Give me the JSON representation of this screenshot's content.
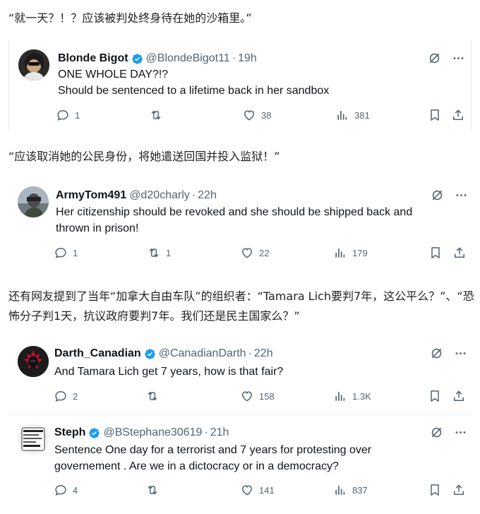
{
  "captions": [
    "“就一天？！？应该被判处终身待在她的沙箱里。”",
    "“应该取消她的公民身份，将她遣送回国并投入监狱！”",
    "还有网友提到了当年“加拿大自由车队”的组织者：“Tamara Lich要判7年，这公平么？”、“恐怖分子判1天，抗议政府要判7年。我们还是民主国家么？”"
  ],
  "tweets": [
    {
      "name": "Blonde Bigot",
      "verified": true,
      "handle": "@BlondeBigot11",
      "sep": "·",
      "time": "19h",
      "text": "ONE WHOLE DAY?!?\nShould be sentenced to a lifetime back in her sandbox",
      "replies": "1",
      "retweets": "",
      "likes": "38",
      "views": "381"
    },
    {
      "name": "ArmyTom491",
      "verified": false,
      "handle": "@d20charly",
      "sep": "·",
      "time": "22h",
      "text": "Her citizenship should be revoked and she should be shipped back and\nthrown in prison!",
      "replies": "1",
      "retweets": "1",
      "likes": "22",
      "views": "179"
    },
    {
      "name": "Darth_Canadian",
      "verified": true,
      "handle": "@CanadianDarth",
      "sep": "·",
      "time": "22h",
      "text": "And Tamara Lich get 7 years, how is that fair?",
      "replies": "2",
      "retweets": "",
      "likes": "158",
      "views": "1.3K"
    },
    {
      "name": "Steph",
      "verified": true,
      "handle": "@BStephane30619",
      "sep": "·",
      "time": "21h",
      "text": "Sentence One day  for a terrorist  and  7 years for  protesting over\ngovernement . Are we in a dictocracy or in a democracy?",
      "replies": "4",
      "retweets": "",
      "likes": "141",
      "views": "837"
    }
  ],
  "icons": {
    "verified": "verified-badge-icon",
    "grok": "grok-icon",
    "more": "more-icon",
    "reply": "reply-icon",
    "retweet": "retweet-icon",
    "like": "like-icon",
    "views": "views-icon",
    "bookmark": "bookmark-icon",
    "share": "share-icon"
  },
  "colors": {
    "verified": "#1d9bf0",
    "muted": "#536471",
    "text": "#0f1419"
  }
}
